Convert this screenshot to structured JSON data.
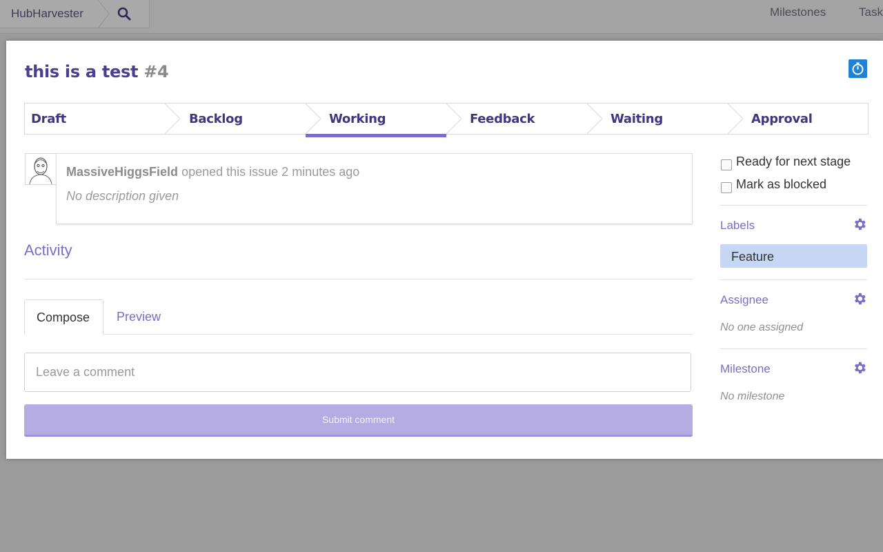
{
  "topbar": {
    "repo": "HubHarvester",
    "nav": [
      "Milestones",
      "Tasks"
    ]
  },
  "issue": {
    "title": "this is a test",
    "number": "#4"
  },
  "stages": [
    "Draft",
    "Backlog",
    "Working",
    "Feedback",
    "Waiting",
    "Approval"
  ],
  "active_stage": "Working",
  "body": {
    "author": "MassiveHiggsField",
    "action": "opened this issue 2 minutes ago",
    "description": "No description given"
  },
  "activity": {
    "heading": "Activity"
  },
  "composer": {
    "tab_compose": "Compose",
    "tab_preview": "Preview",
    "placeholder": "Leave a comment",
    "submit": "Submit comment"
  },
  "sidebar": {
    "ready_label": "Ready for next stage",
    "blocked_label": "Mark as blocked",
    "labels_heading": "Labels",
    "label_item": "Feature",
    "assignee_heading": "Assignee",
    "assignee_value": "No one assigned",
    "milestone_heading": "Milestone",
    "milestone_value": "No milestone"
  },
  "colors": {
    "accent": "#7b6cc6",
    "title": "#4c3f93",
    "label_chip": "#c5d7f2",
    "timer_button": "#1f82d3",
    "submit_bg": "#b5ace3"
  }
}
